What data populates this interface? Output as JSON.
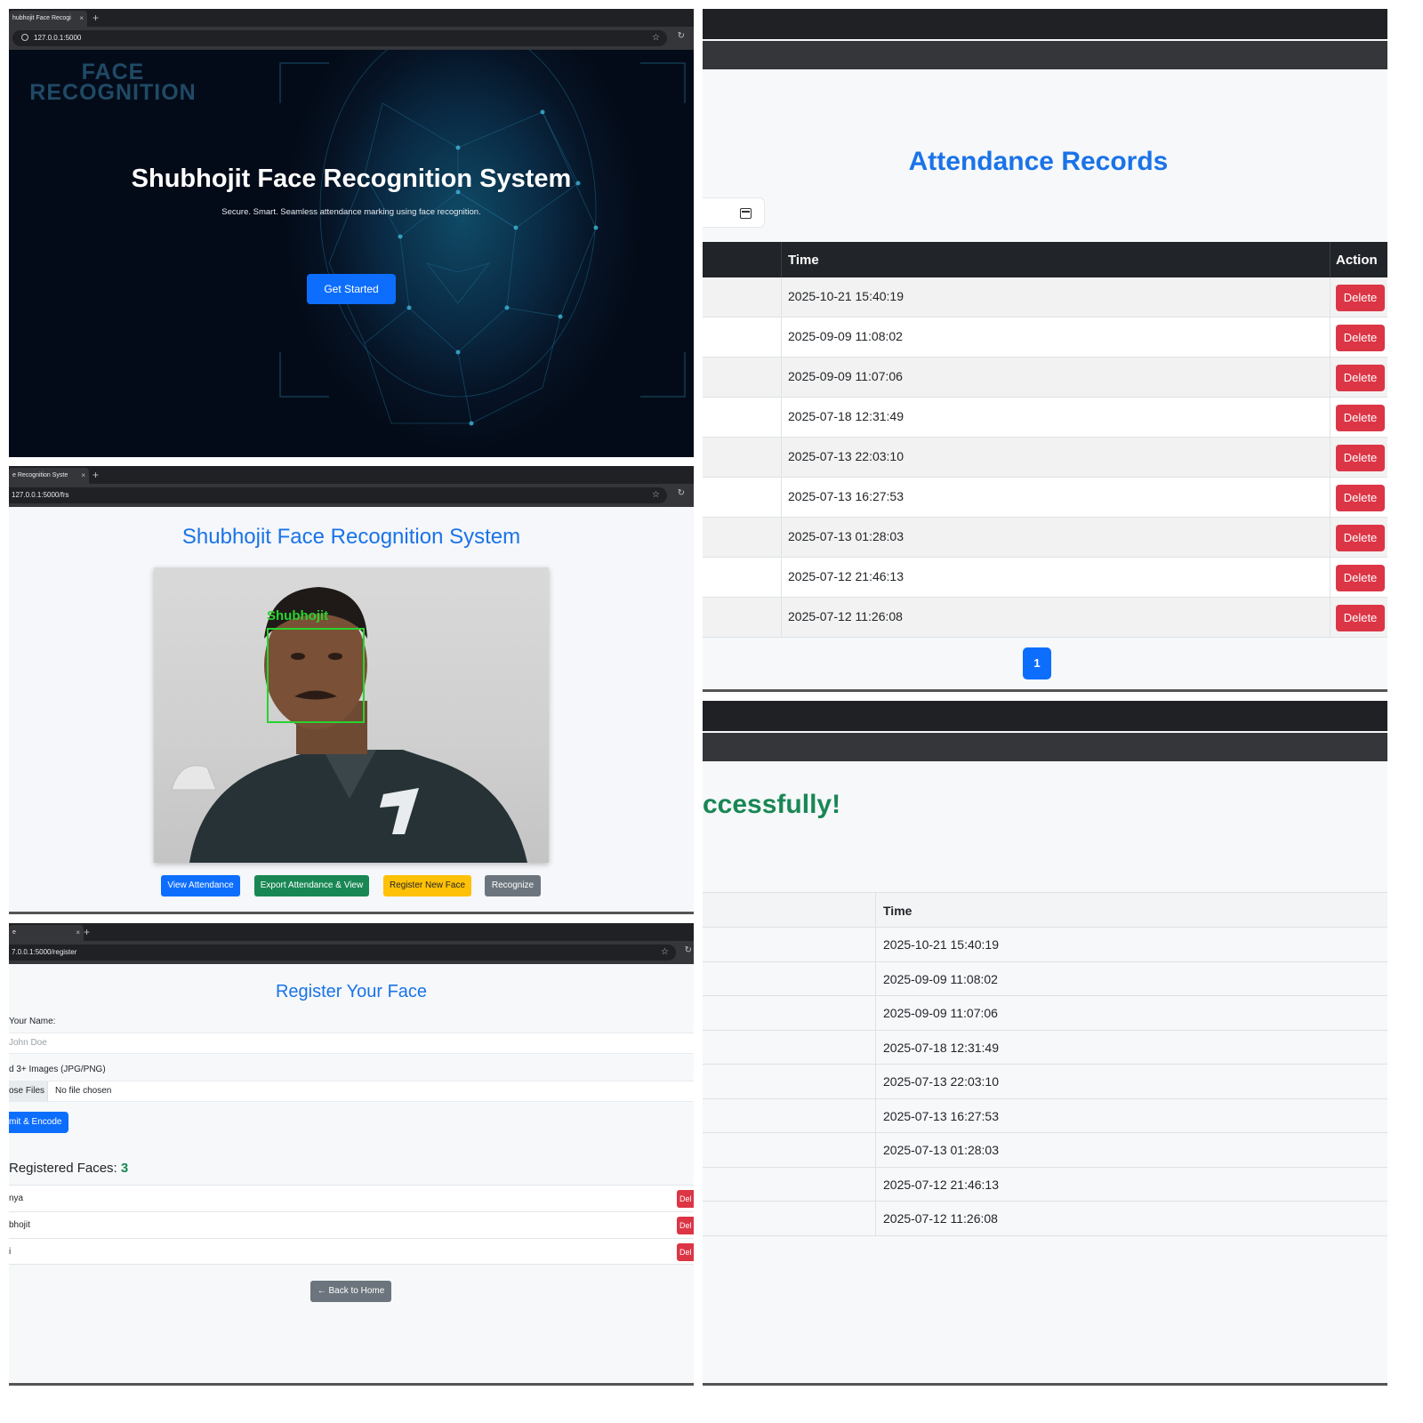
{
  "hero": {
    "tab_title": "hubhojit Face Recogi",
    "url": "127.0.0.1:5000",
    "logo_line1": "FACE",
    "logo_line2": "RECOGNITION",
    "title": "Shubhojit Face Recognition System",
    "subtitle": "Secure. Smart. Seamless attendance marking using face recognition.",
    "cta_label": "Get Started"
  },
  "frs": {
    "tab_title": "e Recognition Syste",
    "url": "127.0.0.1:5000/frs",
    "title": "Shubhojit Face Recognition System",
    "detected_name": "Shubhojit",
    "buttons": {
      "view": "View Attendance",
      "export": "Export Attendance & View",
      "register": "Register New Face",
      "recognize": "Recognize"
    }
  },
  "register": {
    "tab_title": "e",
    "url": "7.0.0.1:5000/register",
    "title": "Register Your Face",
    "name_label": "Your Name:",
    "name_placeholder": "John Doe",
    "images_label": "d 3+ Images (JPG/PNG)",
    "choose_files": "ose Files",
    "no_file": "No file chosen",
    "submit": "mit & Encode",
    "registered_label": "Registered Faces:",
    "registered_count": "3",
    "faces": [
      "nya",
      "bhojit",
      "i"
    ],
    "delete_label": "Del",
    "back": "← Back to Home"
  },
  "attendance": {
    "title": "Attendance Records",
    "columns": {
      "time": "Time",
      "action": "Action"
    },
    "delete_label": "Delete",
    "rows": [
      "2025-10-21 15:40:19",
      "2025-09-09 11:08:02",
      "2025-09-09 11:07:06",
      "2025-07-18 12:31:49",
      "2025-07-13 22:03:10",
      "2025-07-13 16:27:53",
      "2025-07-13 01:28:03",
      "2025-07-12 21:46:13",
      "2025-07-12 11:26:08"
    ],
    "page": "1"
  },
  "export": {
    "message": "ccessfully!",
    "column_time": "Time",
    "rows": [
      "2025-10-21 15:40:19",
      "2025-09-09 11:08:02",
      "2025-09-09 11:07:06",
      "2025-07-18 12:31:49",
      "2025-07-13 22:03:10",
      "2025-07-13 16:27:53",
      "2025-07-13 01:28:03",
      "2025-07-12 21:46:13",
      "2025-07-12 11:26:08"
    ]
  },
  "icons": {
    "close": "×",
    "new_tab": "+",
    "star": "☆",
    "reload": "↻"
  },
  "colors": {
    "primary": "#0d6efd",
    "success": "#198754",
    "danger": "#dc3545",
    "warning": "#ffc107",
    "secondary": "#6c757d",
    "heading_blue": "#1a73e8",
    "detection_green": "#28d22e"
  }
}
